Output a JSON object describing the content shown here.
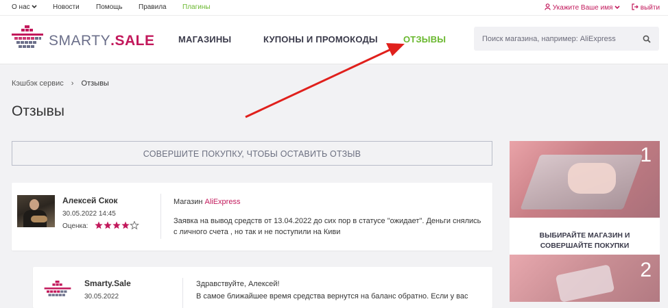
{
  "topbar": {
    "about": "О нас",
    "news": "Новости",
    "help": "Помощь",
    "rules": "Правила",
    "plugins": "Плагины",
    "user": "Укажите Ваше имя",
    "logout": "выйти"
  },
  "header": {
    "logo_text_a": "SMARTY",
    "logo_text_b": ".SALE",
    "nav": [
      "МАГАЗИНЫ",
      "КУПОНЫ И ПРОМОКОДЫ",
      "ОТЗЫВЫ"
    ],
    "search_placeholder": "Поиск магазина, например: AliExpress"
  },
  "breadcrumb": {
    "home": "Кэшбэк сервис",
    "sep": "›",
    "current": "Отзывы"
  },
  "page_title": "Отзывы",
  "cta_label": "СОВЕРШИТЕ ПОКУПКУ, ЧТОБЫ ОСТАВИТЬ ОТЗЫВ",
  "review": {
    "author": "Алексей Скок",
    "date": "30.05.2022 14:45",
    "rating_label": "Оценка:",
    "rating": 4,
    "rating_max": 5,
    "shop_label": "Магазин",
    "shop": "AliExpress",
    "text_line1": "Заявка на вывод средств от 13.04.2022 до сих пор в статусе \"ожидает\". Деньги снялись",
    "text_line2": "с личного счета , но так и не поступили на Киви"
  },
  "reply": {
    "author": "Smarty.Sale",
    "date": "30.05.2022",
    "greeting": "Здравствуйте, Алексей!",
    "text_line1": "В самое ближайшее время средства вернутся на баланс обратно. Если у вас"
  },
  "promo": {
    "step1_num": "1",
    "step1_text_line1": "ВЫБИРАЙТЕ МАГАЗИН И",
    "step1_text_line2": "СОВЕРШАЙТЕ ПОКУПКИ",
    "step2_num": "2"
  },
  "colors": {
    "accent_pink": "#c2185b",
    "accent_green": "#6ab82f",
    "arrow_red": "#e0201c"
  }
}
